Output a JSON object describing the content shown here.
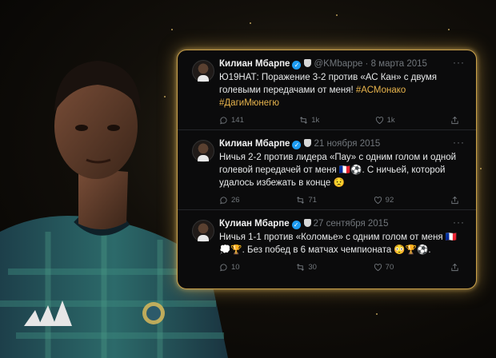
{
  "tweets": [
    {
      "name": "Килиан Мбарпе",
      "handle": "@KMbappe",
      "date": "8 марта 2015",
      "text": "Ю19НАТ: Поражение 3-2 против «АС Кан» с двумя голевыми передачами от меня! ",
      "link1": "#АСМонако",
      "link2": "#ДагиМюнегю",
      "replies": "141",
      "retweets": "1k",
      "likes": "1k"
    },
    {
      "name": "Килиан Мбарпе",
      "handle": "",
      "date": "21 ноября 2015",
      "text": "Ничья 2-2 против лидера «Пау» с одним голом и одной голевой передачей от меня 🇫🇷⚽. С ничьей, которой удалось избежать в конце 😟",
      "replies": "26",
      "retweets": "71",
      "likes": "92"
    },
    {
      "name": "Кулиан Мбарпе",
      "handle": "",
      "date": "27 сентября 2015",
      "text": "Ничья 1-1 против «Коломье» с одним голом от меня 🇫🇷💭🏆. Без побед в 6 матчах чемпионата 😳🏆⚽.",
      "replies": "10",
      "retweets": "30",
      "likes": "70"
    }
  ],
  "colors": {
    "accent_gold": "#c9a04a",
    "link": "#e8b44c",
    "verified": "#1d9bf0",
    "panel_bg": "#0b0b0c"
  },
  "icons": [
    "reply-icon",
    "retweet-icon",
    "like-icon",
    "share-icon",
    "more-icon",
    "verified-icon",
    "club-crest-icon",
    "adidas-logo",
    "real-madrid-crest"
  ]
}
